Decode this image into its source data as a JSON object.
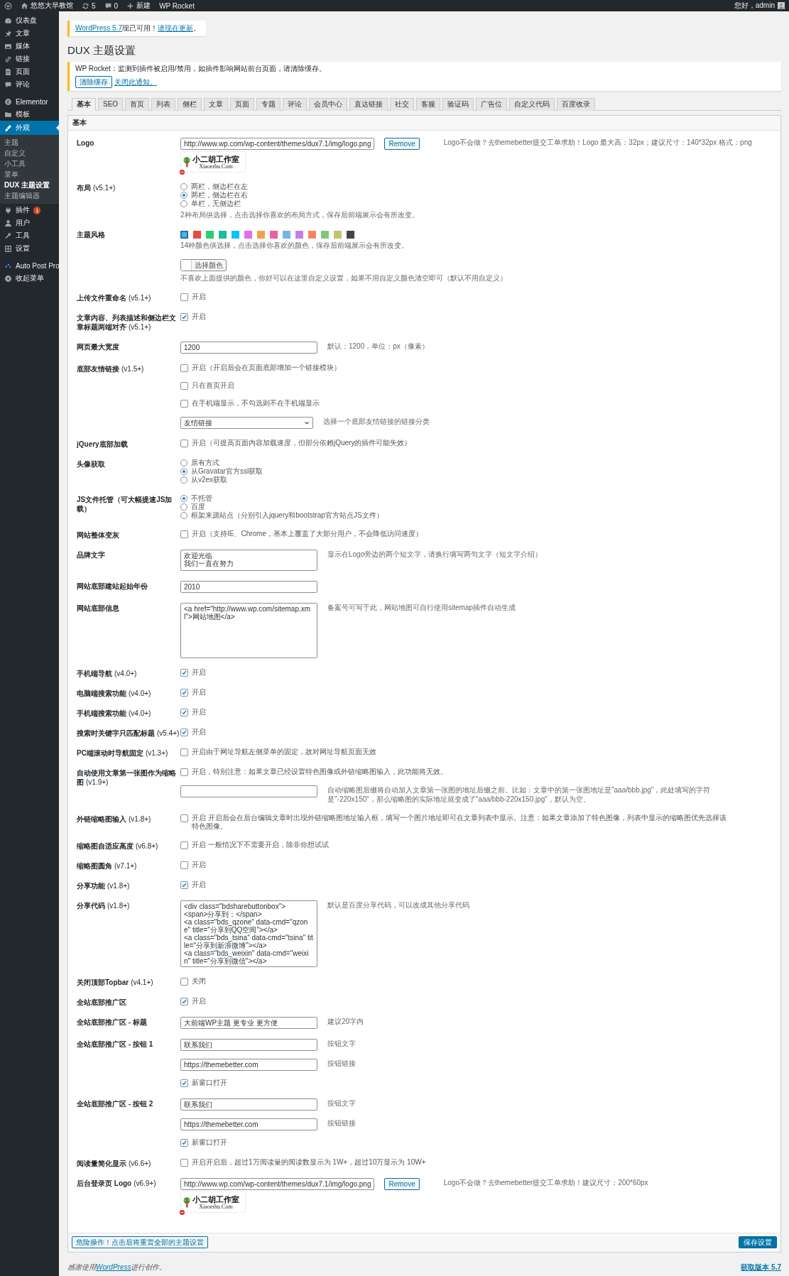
{
  "admin_bar": {
    "items": [
      {
        "kind": "wp"
      },
      {
        "kind": "home",
        "label": "悠悠大早教馆"
      },
      {
        "kind": "updates",
        "label": "5"
      },
      {
        "kind": "comments",
        "label": "0"
      },
      {
        "kind": "new",
        "label": "新建"
      },
      {
        "kind": "plain",
        "label": "WP Rocket"
      }
    ],
    "greeting": "您好，admin"
  },
  "sidebar": {
    "items": [
      {
        "label": "仪表盘",
        "selected": false
      },
      {
        "label": "文章",
        "selected": false
      },
      {
        "label": "媒体",
        "selected": false
      },
      {
        "label": "链接",
        "selected": false
      },
      {
        "label": "页面",
        "selected": false
      },
      {
        "label": "评论",
        "selected": false
      },
      {
        "label": "Elementor",
        "selected": false
      },
      {
        "label": "模板",
        "selected": false
      },
      {
        "label": "外观",
        "selected": true,
        "children": [
          {
            "label": "主题",
            "selected": false
          },
          {
            "label": "自定义",
            "selected": false
          },
          {
            "label": "小工具",
            "selected": false
          },
          {
            "label": "菜单",
            "selected": false
          },
          {
            "label": "DUX 主题设置",
            "selected": true
          },
          {
            "label": "主题编辑器",
            "selected": false
          }
        ]
      },
      {
        "label": "插件",
        "selected": false,
        "badge": "1"
      },
      {
        "label": "用户",
        "selected": false
      },
      {
        "label": "工具",
        "selected": false
      },
      {
        "label": "设置",
        "selected": false
      },
      {
        "label": "Auto Post Pro",
        "selected": false
      },
      {
        "label": "收起菜单",
        "selected": false
      }
    ]
  },
  "update_notice": {
    "version_link": "WordPress 5.7",
    "text": "现已可用！",
    "update_link": "请现在更新",
    "end": "。"
  },
  "page_title": "DUX 主题设置",
  "rocket_notice": {
    "message": "WP Rocket：监测到插件被启用/禁用，如插件影响网站前台页面，请清除缓存。",
    "button": "清除缓存",
    "link": "关闭此通知。"
  },
  "tabs": [
    {
      "label": "基本",
      "selected": true
    },
    {
      "label": "SEO",
      "selected": false
    },
    {
      "label": "首页",
      "selected": false
    },
    {
      "label": "列表",
      "selected": false
    },
    {
      "label": "侧栏",
      "selected": false
    },
    {
      "label": "文章",
      "selected": false
    },
    {
      "label": "页面",
      "selected": false
    },
    {
      "label": "专题",
      "selected": false
    },
    {
      "label": "评论",
      "selected": false
    },
    {
      "label": "会员中心",
      "selected": false
    },
    {
      "label": "直达链接",
      "selected": false
    },
    {
      "label": "社交",
      "selected": false
    },
    {
      "label": "客服",
      "selected": false
    },
    {
      "label": "验证码",
      "selected": false
    },
    {
      "label": "广告位",
      "selected": false
    },
    {
      "label": "自定义代码",
      "selected": false
    },
    {
      "label": "百度收录",
      "selected": false
    }
  ],
  "section": {
    "title": "基本",
    "fields": [
      {
        "label": "Logo",
        "controls": [
          {
            "kind": "upload",
            "value": "http://www.wp.com/wp-content/themes/dux7.1/img/logo.png",
            "button": "Remove",
            "hint": "Logo不会做？去themebetter提交工单求助！Logo 最大高：32px；建议尺寸：140*32px 格式：png",
            "preview": {
              "title": "小二胡工作室",
              "subtitle": "Xiaoerhu.Com"
            }
          }
        ]
      },
      {
        "label": "布局",
        "version": "(v5.1+)",
        "controls": [
          {
            "kind": "radios",
            "options": [
              {
                "label": "两栏，侧边栏在左",
                "selected": false
              },
              {
                "label": "两栏，侧边栏在右",
                "selected": true
              },
              {
                "label": "单栏，无侧边栏",
                "selected": false
              }
            ],
            "note": "2种布局供选择，点击选择你喜欢的布局方式，保存后前端展示会有所改变。"
          }
        ]
      },
      {
        "label": "主题风格",
        "controls": [
          {
            "kind": "colors",
            "swatches": [
              {
                "color": "#45b6f7",
                "selected": true
              },
              {
                "color": "#e74c3c",
                "selected": false
              },
              {
                "color": "#2ecc71",
                "selected": false
              },
              {
                "color": "#1abc9c",
                "selected": false
              },
              {
                "color": "#00c3ff",
                "selected": false
              },
              {
                "color": "#e36be8",
                "selected": false
              },
              {
                "color": "#f7a04a",
                "selected": false
              },
              {
                "color": "#ef5ea0",
                "selected": false
              },
              {
                "color": "#72b6e8",
                "selected": false
              },
              {
                "color": "#c37ee8",
                "selected": false
              },
              {
                "color": "#f7845e",
                "selected": false
              },
              {
                "color": "#7fc67f",
                "selected": false
              },
              {
                "color": "#c2c26a",
                "selected": false
              },
              {
                "color": "#444444",
                "selected": false
              }
            ],
            "note": "14种颜色供选择，点击选择你喜欢的颜色，保存后前端展示会有所改变。"
          },
          {
            "kind": "colorpicker",
            "button": "选择颜色",
            "note": "不喜欢上面提供的颜色，你好可以在这里自定义设置，如果不用自定义颜色清空即可（默认不用自定义）"
          }
        ]
      },
      {
        "label": "上传文件重命名",
        "version": "(v5.1+)",
        "controls": [
          {
            "kind": "checkbox",
            "label": "开启",
            "checked": false
          }
        ]
      },
      {
        "label": "文章内容、列表描述和侧边栏文章标题两端对齐",
        "version": "(v5.1+)",
        "controls": [
          {
            "kind": "checkbox",
            "label": "开启",
            "checked": true
          }
        ]
      },
      {
        "label": "网页最大宽度",
        "controls": [
          {
            "kind": "text",
            "value": "1200",
            "hint": "默认：1200，单位：px（像素）"
          }
        ]
      },
      {
        "label": "底部友情链接",
        "version": "(v1.5+)",
        "controls": [
          {
            "kind": "checkbox",
            "label": "开启（开启后会在页面底部增加一个链接模块）",
            "checked": false
          },
          {
            "kind": "checkbox",
            "label": "只在首页开启",
            "checked": false
          },
          {
            "kind": "checkbox",
            "label": "在手机端显示，不勾选则不在手机端显示",
            "checked": false
          },
          {
            "kind": "select",
            "value": "友情链接",
            "hint": "选择一个底部友情链接的链接分类"
          }
        ]
      },
      {
        "label": "jQuery底部加载",
        "controls": [
          {
            "kind": "checkbox",
            "label": "开启（可提高页面内容加载速度，但部分依赖jQuery的插件可能失效）",
            "checked": false
          }
        ]
      },
      {
        "label": "头像获取",
        "controls": [
          {
            "kind": "radios",
            "options": [
              {
                "label": "原有方式",
                "selected": false
              },
              {
                "label": "从Gravatar官方ssl获取",
                "selected": true
              },
              {
                "label": "从v2ex获取",
                "selected": false
              }
            ]
          }
        ]
      },
      {
        "label": "JS文件托管（可大幅提速JS加载）",
        "controls": [
          {
            "kind": "radios",
            "options": [
              {
                "label": "不托管",
                "selected": true
              },
              {
                "label": "百度",
                "selected": false
              },
              {
                "label": "框架来源站点（分别引入jquery和bootstrap官方站点JS文件）",
                "selected": false
              }
            ]
          }
        ]
      },
      {
        "label": "网站整体变灰",
        "controls": [
          {
            "kind": "checkbox",
            "label": "开启（支持IE、Chrome，基本上覆盖了大部分用户，不会降低访问速度）",
            "checked": false
          }
        ]
      },
      {
        "label": "品牌文字",
        "controls": [
          {
            "kind": "memo",
            "lines": [
              "欢迎光临",
              "我们一直在努力"
            ],
            "hint": "显示在Logo旁边的两个短文字，请换行填写两句文字（短文字介绍）"
          }
        ]
      },
      {
        "label": "网站底部建站起始年份",
        "controls": [
          {
            "kind": "text",
            "value": "2010"
          }
        ]
      },
      {
        "label": "网站底部信息",
        "controls": [
          {
            "kind": "textarea",
            "lines": [
              "<a href=\"http://www.wp.com/sitemap.xml\">网站地图</a>"
            ],
            "hint": "备案号可写于此，网站地图可自行使用sitemap插件自动生成"
          }
        ]
      },
      {
        "label": "手机端导航",
        "version": "(v4.0+)",
        "controls": [
          {
            "kind": "checkbox",
            "label": "开启",
            "checked": true
          }
        ]
      },
      {
        "label": "电脑端搜索功能",
        "version": "(v4.0+)",
        "controls": [
          {
            "kind": "checkbox",
            "label": "开启",
            "checked": true
          }
        ]
      },
      {
        "label": "手机端搜索功能",
        "version": "(v4.0+)",
        "controls": [
          {
            "kind": "checkbox",
            "label": "开启",
            "checked": true
          }
        ]
      },
      {
        "label": "搜索时关键字只匹配标题",
        "version": "(v5.4+)",
        "controls": [
          {
            "kind": "checkbox",
            "label": "开启",
            "checked": true
          }
        ]
      },
      {
        "label": "PC端滚动时导航固定",
        "version": "(v1.3+)",
        "controls": [
          {
            "kind": "checkbox",
            "label": "开启由于网址导航左侧菜单的固定，故对网址导航页面无效",
            "checked": false
          }
        ]
      },
      {
        "label": "自动使用文章第一张图作为缩略图",
        "version": "(v1.9+)",
        "controls": [
          {
            "kind": "checkbox",
            "label": "开启，特别注意：如果文章已经设置特色图像或外链缩略图输入，此功能将无效。",
            "checked": false
          },
          {
            "kind": "text",
            "hint": "自动缩略图后缀将自动加入文章第一张图的地址后缀之前。比如：文章中的第一张图地址是\"aaa/bbb.jpg\"，此处填写的字符是\"-220x150\"，那么缩略图的实际地址就变成了\"aaa/bbb-220x150.jpg\"，默认为空。"
          }
        ]
      },
      {
        "label": "外链缩略图输入",
        "version": "(v1.8+)",
        "controls": [
          {
            "kind": "checkbox",
            "label": "开启 开启后会在后台编辑文章时出现外链缩略图地址输入框，填写一个图片地址即可在文章列表中显示。注意：如果文章添加了特色图像，列表中显示的缩略图优先选择该特色图像。",
            "checked": false
          }
        ]
      },
      {
        "label": "缩略图自适应高度",
        "version": "(v6.8+)",
        "controls": [
          {
            "kind": "checkbox",
            "label": "开启 一般情况下不需要开启，除非你想试试",
            "checked": false
          }
        ]
      },
      {
        "label": "缩略图圆角",
        "version": "(v7.1+)",
        "controls": [
          {
            "kind": "checkbox",
            "label": "开启",
            "checked": false
          }
        ]
      },
      {
        "label": "分享功能",
        "version": "(v1.8+)",
        "controls": [
          {
            "kind": "checkbox",
            "label": "开启",
            "checked": true
          }
        ]
      },
      {
        "label": "分享代码",
        "version": "(v1.8+)",
        "controls": [
          {
            "kind": "textarea",
            "lines": [
              "<div class=\"bdsharebuttonbox\">",
              "<span>分享到：</span>",
              "<a class=\"bds_qzone\" data-cmd=\"qzone\" title=\"分享到QQ空间\"></a>",
              "<a class=\"bds_tsina\" data-cmd=\"tsina\" title=\"分享到新浪微博\"></a>",
              "<a class=\"bds_weixin\" data-cmd=\"weixin\" title=\"分享到微信\"></a>"
            ],
            "hint": "默认是百度分享代码，可以改成其他分享代码"
          }
        ]
      },
      {
        "label": "关闭顶部Topbar",
        "version": "(v4.1+)",
        "controls": [
          {
            "kind": "checkbox",
            "label": "关闭",
            "checked": false
          }
        ]
      },
      {
        "label": "全站底部推广区",
        "controls": [
          {
            "kind": "checkbox",
            "label": "开启",
            "checked": true
          }
        ]
      },
      {
        "label": "全站底部推广区 - 标题",
        "controls": [
          {
            "kind": "text",
            "value": "大前端WP主题 更专业 更方便",
            "hint": "建议20字内"
          }
        ]
      },
      {
        "label": "全站底部推广区 - 按钮 1",
        "controls": [
          {
            "kind": "text",
            "value": "联系我们",
            "hint": "按钮文字"
          },
          {
            "kind": "text",
            "value": "https://themebetter.com",
            "hint": "按钮链接"
          },
          {
            "kind": "checkbox",
            "label": "新窗口打开",
            "checked": true
          }
        ]
      },
      {
        "label": "全站底部推广区 - 按钮 2",
        "controls": [
          {
            "kind": "text",
            "value": "联系我们",
            "hint": "按钮文字"
          },
          {
            "kind": "text",
            "value": "https://themebetter.com",
            "hint": "按钮链接"
          },
          {
            "kind": "checkbox",
            "label": "新窗口打开",
            "checked": true
          }
        ]
      },
      {
        "label": "阅读量简化显示",
        "version": "(v6.6+)",
        "controls": [
          {
            "kind": "checkbox",
            "label": "开启开启后，超过1万阅读量的阅读数显示为 1W+，超过10万显示为 10W+",
            "checked": false
          }
        ]
      },
      {
        "label": "后台登录页 Logo",
        "version": "(v6.9+)",
        "controls": [
          {
            "kind": "upload",
            "value": "http://www.wp.com/wp-content/themes/dux7.1/img/logo.png",
            "button": "Remove",
            "hint": "Logo不会做？去themebetter提交工单求助！建议尺寸：200*60px",
            "preview": {
              "title": "小二胡工作室",
              "subtitle": "Xiaoerhu.Com"
            }
          }
        ]
      }
    ]
  },
  "actions": {
    "reset": "危险操作！点击后将重置全部的主题设置",
    "save": "保存设置"
  },
  "footer": {
    "before": "感谢使用",
    "link": "WordPress",
    "after": "进行创作。",
    "version": "获取版本 5.7"
  }
}
